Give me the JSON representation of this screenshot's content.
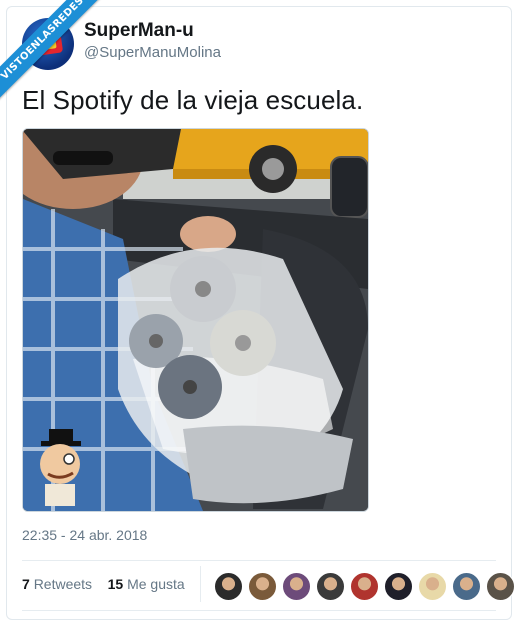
{
  "watermark": {
    "text": "VISTOENLASREDES"
  },
  "user": {
    "display_name": "SuperMan-u",
    "handle": "@SuperManuMolina"
  },
  "tweet": {
    "text": "El Spotify de la vieja escuela.",
    "timestamp": "22:35 - 24 abr. 2018"
  },
  "stats": {
    "retweets_count": "7",
    "retweets_label": "Retweets",
    "likes_count": "15",
    "likes_label": "Me gusta"
  },
  "likers": [
    {
      "color": "#2b2b2b"
    },
    {
      "color": "#7a5a3a"
    },
    {
      "color": "#6d4b7a"
    },
    {
      "color": "#3a3a3a"
    },
    {
      "color": "#b0342e"
    },
    {
      "color": "#1f1f2a"
    },
    {
      "color": "#e8d9a8"
    },
    {
      "color": "#4a6a8a"
    },
    {
      "color": "#5a5248"
    }
  ],
  "colors": {
    "accent": "#1da1f2",
    "ribbon": "#1d8fd6",
    "secondary_text": "#657786"
  }
}
